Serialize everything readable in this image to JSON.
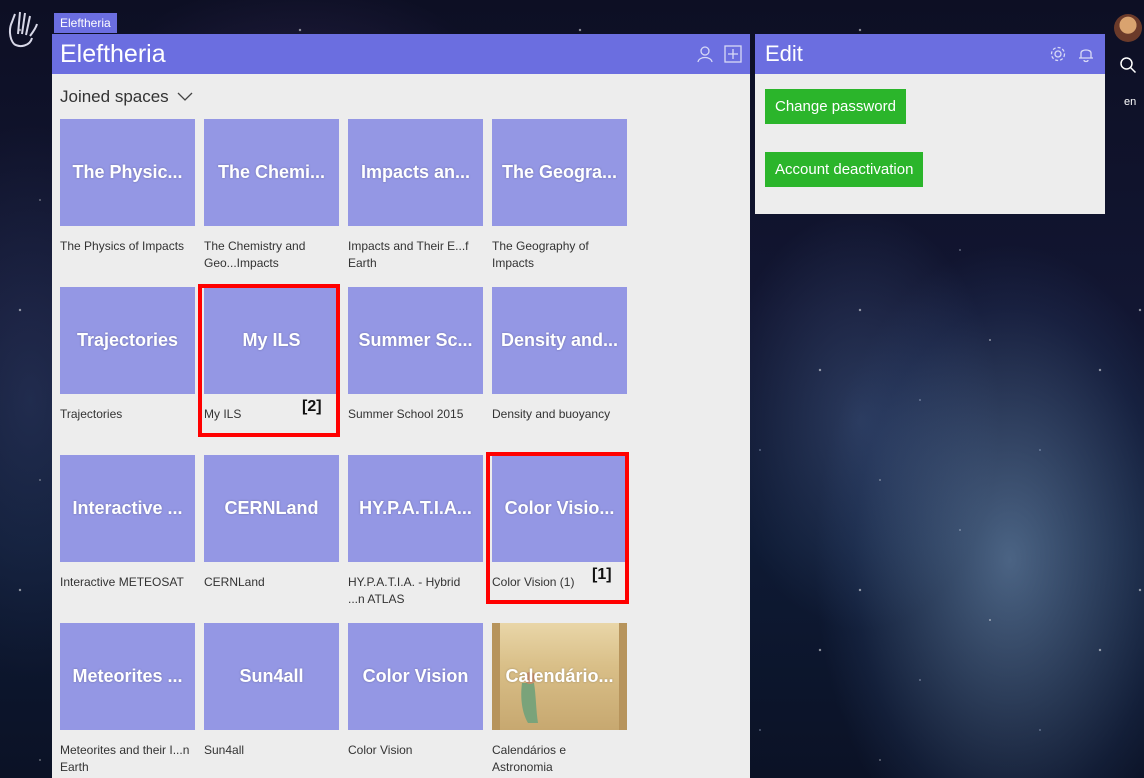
{
  "app": {
    "breadcrumb_tab": "Eleftheria"
  },
  "left_panel": {
    "title": "Eleftheria",
    "section_title": "Joined spaces",
    "tiles": [
      {
        "thumb": "The Physic...",
        "caption": "The Physics of Impacts"
      },
      {
        "thumb": "The Chemi...",
        "caption": "The Chemistry and Geo...Impacts"
      },
      {
        "thumb": "Impacts an...",
        "caption": "Impacts and Their E...f Earth"
      },
      {
        "thumb": "The Geogra...",
        "caption": "The Geography of Impacts"
      },
      {
        "thumb": "Trajectories",
        "caption": "Trajectories"
      },
      {
        "thumb": "My ILS",
        "caption": "My ILS"
      },
      {
        "thumb": "Summer Sc...",
        "caption": "Summer School 2015"
      },
      {
        "thumb": "Density and...",
        "caption": "Density and buoyancy"
      },
      {
        "thumb": "Interactive ...",
        "caption": "Interactive METEOSAT"
      },
      {
        "thumb": "CERNLand",
        "caption": "CERNLand"
      },
      {
        "thumb": "HY.P.A.T.I.A...",
        "caption": "HY.P.A.T.I.A. - Hybrid ...n ATLAS"
      },
      {
        "thumb": "Color Visio...",
        "caption": "Color Vision (1)"
      },
      {
        "thumb": "Meteorites ...",
        "caption": "Meteorites and their I...n Earth"
      },
      {
        "thumb": "Sun4all",
        "caption": "Sun4all"
      },
      {
        "thumb": "Color Vision",
        "caption": "Color Vision"
      },
      {
        "thumb": "Calendário...",
        "caption": "Calendários e Astronomia"
      }
    ]
  },
  "markers": [
    {
      "label": "[1]"
    },
    {
      "label": "[2]"
    }
  ],
  "edit_panel": {
    "title": "Edit",
    "change_password_label": "Change password",
    "account_deactivation_label": "Account deactivation"
  },
  "side": {
    "language": "en"
  },
  "colors": {
    "header": "#6b6ee0",
    "tile": "#9497e4",
    "button": "#2bb52b",
    "marker": "#ff0000"
  }
}
